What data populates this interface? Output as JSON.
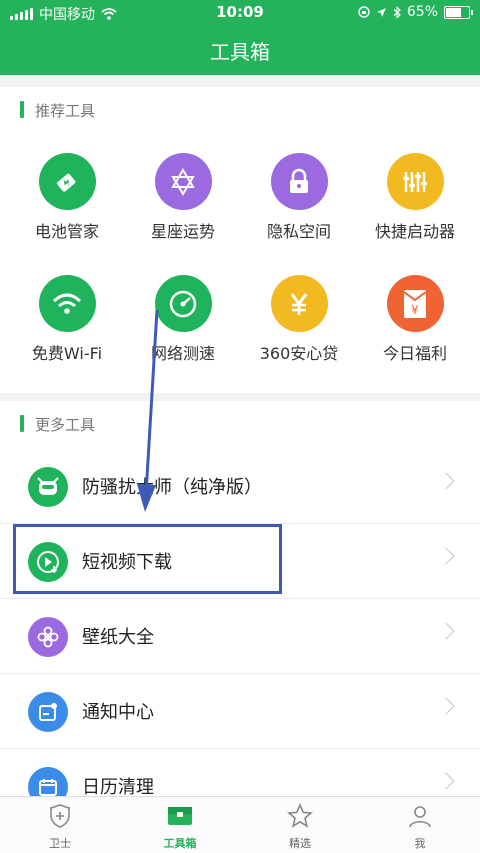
{
  "status_bar": {
    "carrier": "中国移动",
    "time": "10:09",
    "battery": "65%"
  },
  "header": {
    "title": "工具箱"
  },
  "recommended": {
    "label": "推荐工具",
    "tools": [
      {
        "name": "电池管家",
        "icon": "battery-icon",
        "color": "#1fb35b"
      },
      {
        "name": "星座运势",
        "icon": "star-of-david-icon",
        "color": "#9b6ae0"
      },
      {
        "name": "隐私空间",
        "icon": "lock-icon",
        "color": "#9b6ae0"
      },
      {
        "name": "快捷启动器",
        "icon": "sliders-icon",
        "color": "#f3b921"
      },
      {
        "name": "免费Wi-Fi",
        "icon": "wifi-icon",
        "color": "#1fb35b"
      },
      {
        "name": "网络测速",
        "icon": "speedometer-icon",
        "color": "#1fb35b"
      },
      {
        "name": "360安心贷",
        "icon": "yen-icon",
        "color": "#f3b921"
      },
      {
        "name": "今日福利",
        "icon": "red-envelope-icon",
        "color": "#f06433"
      }
    ]
  },
  "more": {
    "label": "更多工具",
    "items": [
      {
        "name": "防骚扰大师（纯净版）",
        "icon": "robot-face-icon",
        "color": "#1fb35b"
      },
      {
        "name": "短视频下载",
        "icon": "video-download-icon",
        "color": "#1fb35b"
      },
      {
        "name": "壁纸大全",
        "icon": "flower-icon",
        "color": "#9b6ae0"
      },
      {
        "name": "通知中心",
        "icon": "notification-icon",
        "color": "#3b8be8"
      },
      {
        "name": "日历清理",
        "icon": "calendar-icon",
        "color": "#3b8be8"
      }
    ]
  },
  "tabs": [
    {
      "label": "卫士",
      "icon": "shield-icon"
    },
    {
      "label": "工具箱",
      "icon": "toolbox-icon",
      "active": true
    },
    {
      "label": "精选",
      "icon": "star-icon"
    },
    {
      "label": "我",
      "icon": "user-icon"
    }
  ],
  "accent_colors": {
    "primary": "#24b35a",
    "annotation": "#3d5ab8"
  }
}
